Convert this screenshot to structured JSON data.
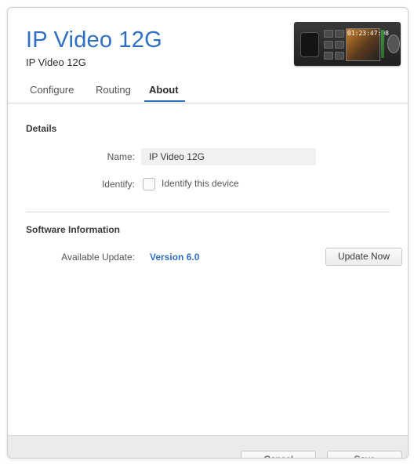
{
  "header": {
    "title": "IP Video 12G",
    "subtitle": "IP Video 12G",
    "device_time": "01:23:47:08"
  },
  "tabs": [
    {
      "label": "Configure",
      "active": false
    },
    {
      "label": "Routing",
      "active": false
    },
    {
      "label": "About",
      "active": true
    }
  ],
  "details": {
    "section_title": "Details",
    "name_label": "Name:",
    "name_value": "IP Video 12G",
    "identify_label": "Identify:",
    "identify_checkbox_label": "Identify this device",
    "identify_checked": false
  },
  "software": {
    "section_title": "Software Information",
    "available_update_label": "Available Update:",
    "version_link": "Version 6.0",
    "update_button": "Update Now"
  },
  "footer": {
    "cancel_label": "Cancel",
    "save_label": "Save"
  },
  "colors": {
    "accent": "#2f6fc4",
    "footer_bg": "#ebebeb",
    "input_bg": "#f1f1f1"
  }
}
